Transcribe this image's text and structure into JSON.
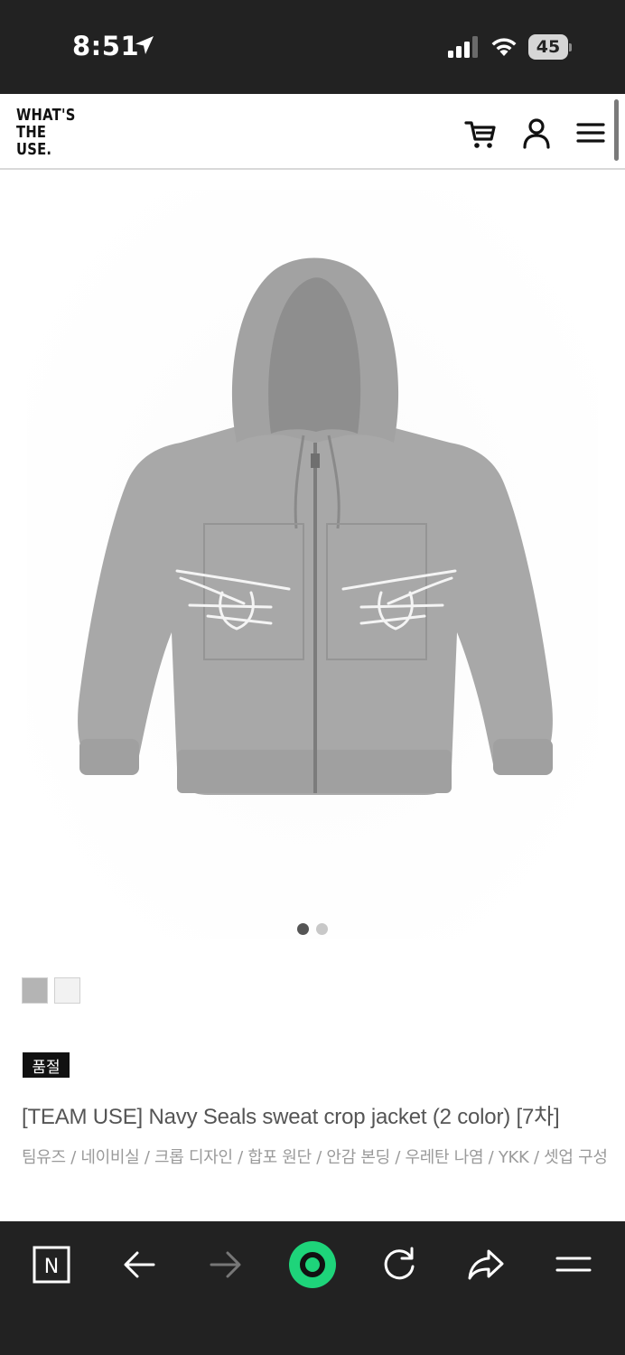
{
  "status_bar": {
    "time": "8:51",
    "battery": "45",
    "icons": [
      "location-arrow-icon",
      "cellular-signal-icon",
      "wifi-icon",
      "battery-icon"
    ]
  },
  "header": {
    "logo_lines": [
      "WHAT'S",
      "THE",
      "USE."
    ],
    "icons": [
      "cart-icon",
      "user-icon",
      "menu-icon"
    ]
  },
  "product": {
    "image_alt": "Grey zip-up hoodie with Navy Seals eagle trident print",
    "swatch_colors": [
      "#b4b4b4",
      "#f2f2f2"
    ],
    "badge": "품절",
    "title": "[TEAM USE] Navy Seals sweat crop jacket (2 color) [7차]",
    "description": "팀유즈 / 네이비실 / 크롭 디자인 / 합포 원단 / 안감 본딩 / 우레탄 나염 / YKK / 셋업 구성"
  },
  "carousel": {
    "total": 2,
    "active": 1
  },
  "browser_toolbar": {
    "n_label": "N",
    "accent_color": "#1ed47a",
    "icons": [
      "naver-n-icon",
      "back-arrow-icon",
      "forward-arrow-icon",
      "home-circle-icon",
      "reload-icon",
      "share-icon",
      "more-menu-icon"
    ]
  }
}
